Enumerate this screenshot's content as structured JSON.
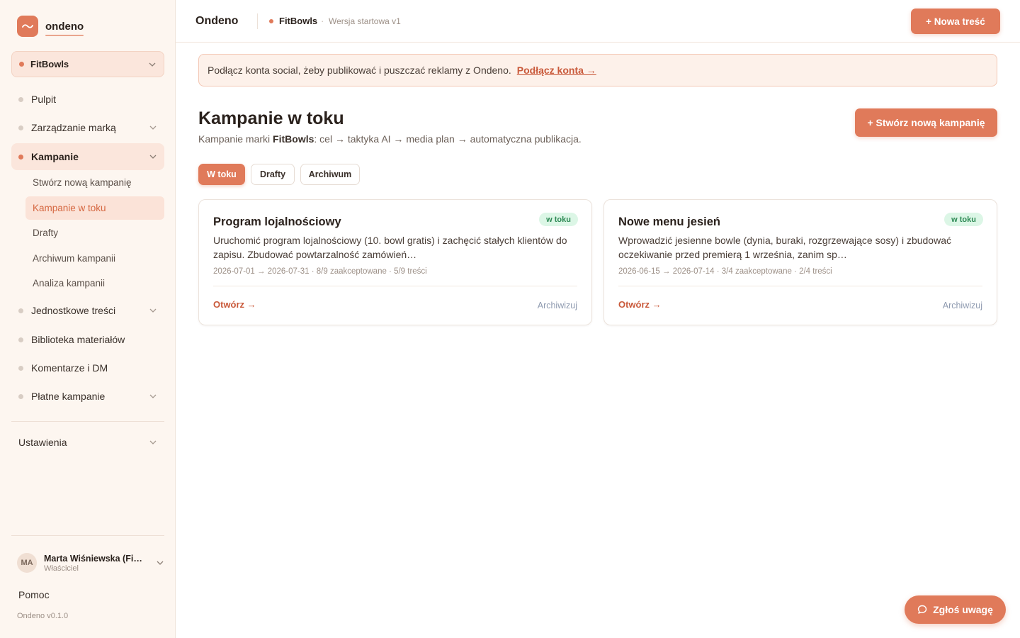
{
  "app": {
    "logo_text": "ondeno",
    "title": "Ondeno",
    "version": "Ondeno v0.1.0"
  },
  "breadcrumb": {
    "brand": "FitBowls",
    "separator": "·",
    "version": "Wersja startowa v1"
  },
  "header": {
    "new_content_label": "+ Nowa treść"
  },
  "sidebar": {
    "brand_select": "FitBowls",
    "items": [
      {
        "label": "Pulpit"
      },
      {
        "label": "Zarządzanie marką"
      },
      {
        "label": "Kampanie"
      },
      {
        "label": "Jednostkowe treści"
      },
      {
        "label": "Biblioteka materiałów"
      },
      {
        "label": "Komentarze i DM"
      },
      {
        "label": "Płatne kampanie"
      }
    ],
    "sub_items": [
      {
        "label": "Stwórz nową kampanię"
      },
      {
        "label": "Kampanie w toku"
      },
      {
        "label": "Drafty"
      },
      {
        "label": "Archiwum kampanii"
      },
      {
        "label": "Analiza kampanii"
      }
    ],
    "settings": "Ustawienia",
    "user": {
      "initials": "MA",
      "name": "Marta Wiśniewska (FitBowls)",
      "role": "Właściciel"
    },
    "help": "Pomoc"
  },
  "banner": {
    "text": "Podłącz konta social, żeby publikować i puszczać reklamy z Ondeno.",
    "link": "Podłącz konta →"
  },
  "page": {
    "title": "Kampanie w toku",
    "subtitle_prefix": "Kampanie marki ",
    "subtitle_brand": "FitBowls",
    "subtitle_suffix": ": cel → taktyka AI → media plan → automatyczna publikacja.",
    "create_label": "+ Stwórz nową kampanię"
  },
  "tabs": [
    {
      "label": "W toku"
    },
    {
      "label": "Drafty"
    },
    {
      "label": "Archiwum"
    }
  ],
  "campaigns": [
    {
      "title": "Program lojalnościowy",
      "status": "w toku",
      "description": "Uruchomić program lojalnościowy (10. bowl gratis) i zachęcić stałych klientów do zapisu. Zbudować powtarzalność zamówień…",
      "meta": "2026-07-01 → 2026-07-31 · 8/9 zaakceptowane · 5/9 treści",
      "open_label": "Otwórz →",
      "archive_label": "Archiwizuj"
    },
    {
      "title": "Nowe menu jesień",
      "status": "w toku",
      "description": "Wprowadzić jesienne bowle (dynia, buraki, rozgrzewające sosy) i zbudować oczekiwanie przed premierą 1 września, zanim sp…",
      "meta": "2026-06-15 → 2026-07-14 · 3/4 zaakceptowane · 2/4 treści",
      "open_label": "Otwórz →",
      "archive_label": "Archiwizuj"
    }
  ],
  "feedback": {
    "label": "Zgłoś uwagę"
  },
  "colors": {
    "accent": "#e07a5a",
    "sidebar_bg": "#fdf6f0",
    "badge_bg": "#dcf6e6",
    "badge_text": "#2e8a55"
  }
}
